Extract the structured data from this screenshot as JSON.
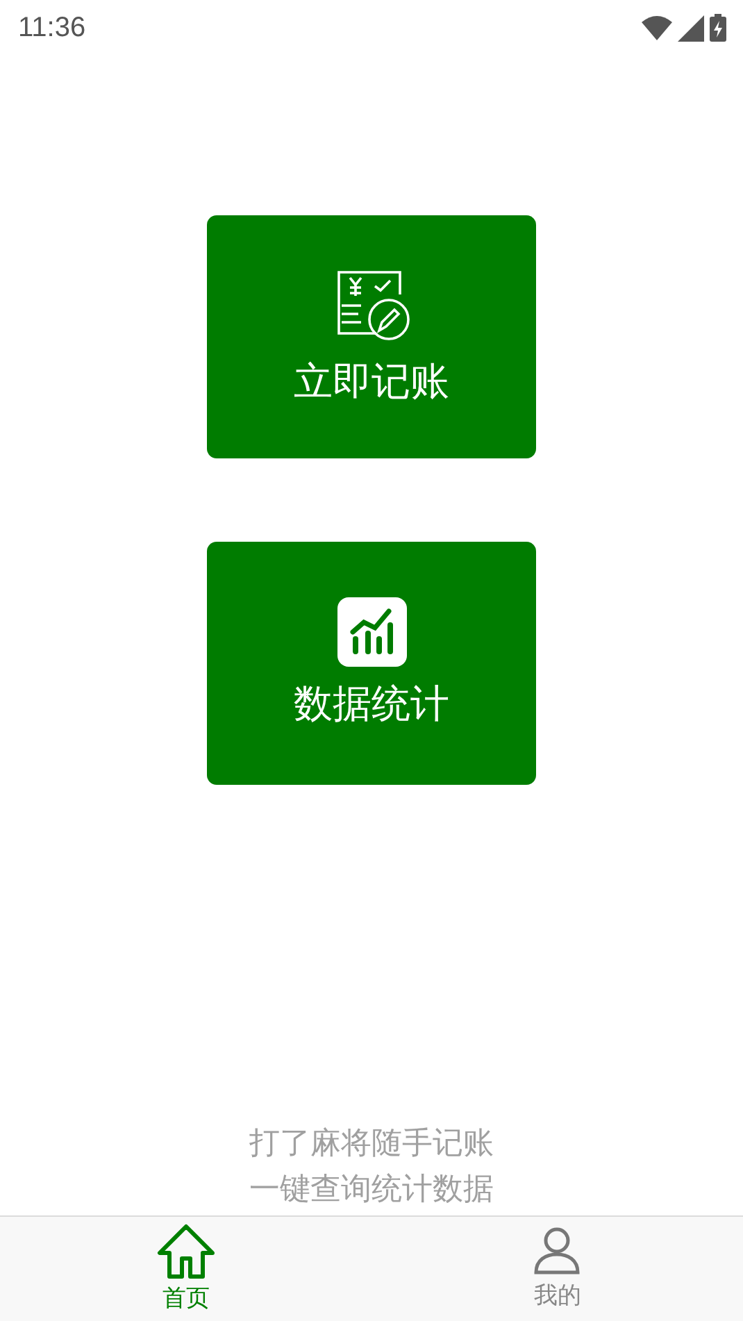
{
  "status_bar": {
    "time": "11:36"
  },
  "actions": [
    {
      "kind": "record",
      "label": "立即记账"
    },
    {
      "kind": "stats",
      "label": "数据统计"
    }
  ],
  "tagline": [
    "打了麻将随手记账",
    "一键查询统计数据"
  ],
  "tabs": [
    {
      "kind": "home",
      "label": "首页",
      "selected": true
    },
    {
      "kind": "profile",
      "label": "我的",
      "selected": false
    }
  ]
}
